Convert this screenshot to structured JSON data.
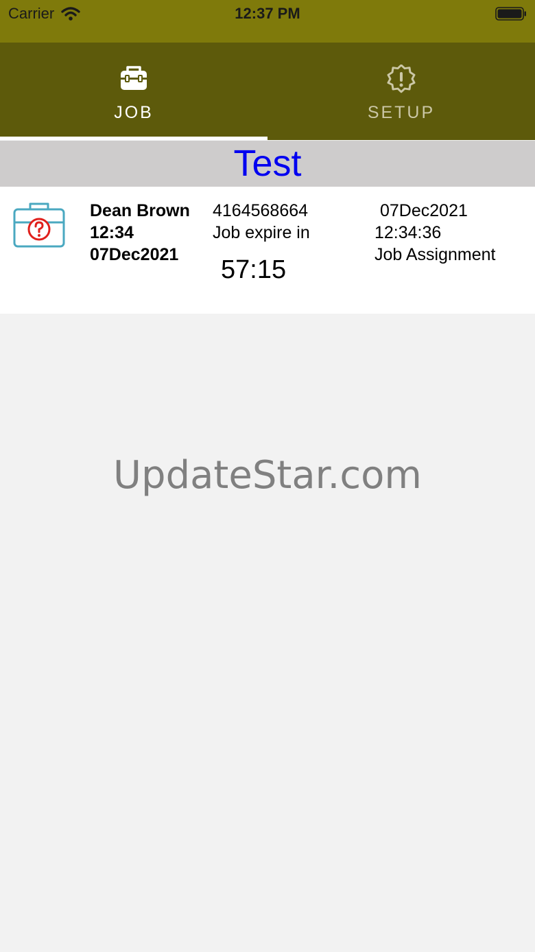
{
  "status_bar": {
    "carrier": "Carrier",
    "time": "12:37 PM",
    "wifi_icon": "wifi-icon",
    "battery_icon": "battery-icon"
  },
  "tabs": [
    {
      "label": "JOB",
      "icon": "toolbox-icon",
      "selected": true
    },
    {
      "label": "SETUP",
      "icon": "alert-badge-icon",
      "selected": false
    }
  ],
  "section": {
    "title": "Test"
  },
  "job": {
    "icon": "briefcase-question-icon",
    "name": "Dean Brown",
    "time": "12:34",
    "date": "07Dec2021",
    "phone": "4164568664",
    "expire_label": "Job expire in",
    "countdown": "57:15",
    "assigned_date": "07Dec2021",
    "assigned_time": "12:34:36",
    "type": "Job Assignment"
  },
  "watermark": "UpdateStar.com",
  "colors": {
    "status_bar": "#7f7a0b",
    "tab_bar": "#5d5a0b",
    "section_title": "#0000f0",
    "section_bg": "#cecccc",
    "icon_red": "#e0201c",
    "icon_teal": "#4aa8c0"
  }
}
